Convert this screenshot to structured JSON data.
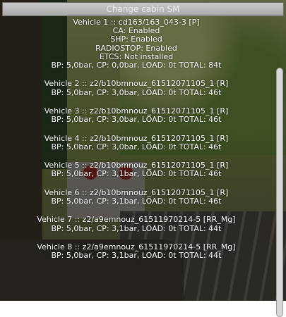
{
  "window": {
    "title": "Change cabin SM"
  },
  "vehicles": [
    {
      "header": "Vehicle 1 :: cd163/163_043-3 [P]",
      "details": [
        "CA: Enabled",
        "SHP: Enabled",
        "RADIOSTOP: Enabled",
        "ETCS: Not installed"
      ],
      "status": "BP: 5,0bar, CP: 0,0bar, LOAD: 0t TOTAL: 84t"
    },
    {
      "header": "Vehicle 2 :: z2/b10bmnouz_61512071105_1 [R]",
      "status": "BP: 5,0bar, CP: 3,0bar, LOAD: 0t TOTAL: 46t"
    },
    {
      "header": "Vehicle 3 :: z2/b10bmnouz_61512071105_1 [R]",
      "status": "BP: 5,0bar, CP: 3,0bar, LOAD: 0t TOTAL: 46t"
    },
    {
      "header": "Vehicle 4 :: z2/b10bmnouz_61512071105_1 [R]",
      "status": "BP: 5,0bar, CP: 3,0bar, LOAD: 0t TOTAL: 46t"
    },
    {
      "header": "Vehicle 5 :: z2/b10bmnouz_61512071105_1 [R]",
      "status": "BP: 5,0bar, CP: 3,1bar, LOAD: 0t TOTAL: 46t"
    },
    {
      "header": "Vehicle 6 :: z2/b10bmnouz_61512071105_1 [R]",
      "status": "BP: 5,0bar, CP: 3,1bar, LOAD: 0t TOTAL: 46t"
    },
    {
      "header": "Vehicle 7 :: z2/a9emnouz_61511970214-5 [RR_Mg]",
      "status": "BP: 5,0bar, CP: 3,1bar, LOAD: 0t TOTAL: 44t"
    },
    {
      "header": "Vehicle 8 :: z2/a9emnouz_61511970214-5 [RR_Mg]",
      "status": "BP: 5,0bar, CP: 3,1bar, LOAD: 0t TOTAL: 44t"
    }
  ],
  "scroll": {
    "position_fraction": 0.0
  }
}
